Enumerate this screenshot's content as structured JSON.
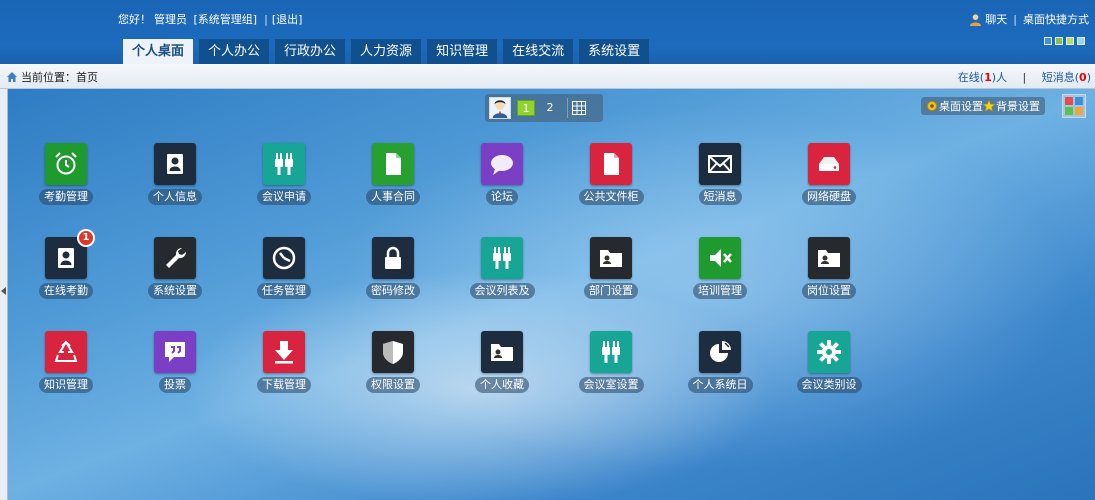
{
  "header": {
    "greeting": "您好！",
    "user_name": "管理员",
    "user_group": "[系统管理组]",
    "logout": "[退出]",
    "chat": "聊天",
    "shortcut": "桌面快捷方式"
  },
  "nav": {
    "tabs": [
      {
        "label": "个人桌面",
        "active": true
      },
      {
        "label": "个人办公",
        "active": false
      },
      {
        "label": "行政办公",
        "active": false
      },
      {
        "label": "人力资源",
        "active": false
      },
      {
        "label": "知识管理",
        "active": false
      },
      {
        "label": "在线交流",
        "active": false
      },
      {
        "label": "系统设置",
        "active": false
      }
    ]
  },
  "breadcrumb": {
    "label": "当前位置：",
    "current": "首页"
  },
  "status": {
    "online_label": "在线(",
    "online_count": "1",
    "online_suffix": ")人",
    "messages_label": "短消息(",
    "messages_count": "0",
    "messages_suffix": ")"
  },
  "pager": {
    "pages": [
      "1",
      "2"
    ],
    "active_page": "1"
  },
  "desk_tools": {
    "desktop_settings": "桌面设置",
    "background_settings": "背景设置"
  },
  "theme_colors": [
    "#3f8fdc",
    "#88c04a",
    "#b5e05d",
    "#9ed0f0"
  ],
  "apps": [
    {
      "label": "考勤管理",
      "color": "#1f9a2e",
      "icon": "alarm-clock-icon"
    },
    {
      "label": "个人信息",
      "color": "#1e2c3f",
      "icon": "person-icon"
    },
    {
      "label": "会议申请",
      "color": "#17a696",
      "icon": "plug-icon"
    },
    {
      "label": "人事合同",
      "color": "#27a030",
      "icon": "document-icon"
    },
    {
      "label": "论坛",
      "color": "#7a3fc4",
      "icon": "speech-bubble-icon"
    },
    {
      "label": "公共文件柜",
      "color": "#d8243f",
      "icon": "file-icon"
    },
    {
      "label": "短消息",
      "color": "#1e2c3f",
      "icon": "envelope-icon"
    },
    {
      "label": "网络硬盘",
      "color": "#d8243f",
      "icon": "hard-drive-icon"
    },
    {
      "label": "在线考勤",
      "color": "#1e2c3f",
      "icon": "person-icon",
      "badge": "1"
    },
    {
      "label": "系统设置",
      "color": "#262a2e",
      "icon": "wrench-icon"
    },
    {
      "label": "任务管理",
      "color": "#1e2c3f",
      "icon": "clock-icon"
    },
    {
      "label": "密码修改",
      "color": "#1e2c3f",
      "icon": "lock-icon"
    },
    {
      "label": "会议列表及",
      "color": "#17a696",
      "icon": "plug-icon"
    },
    {
      "label": "部门设置",
      "color": "#262a2e",
      "icon": "id-folder-icon"
    },
    {
      "label": "培训管理",
      "color": "#1f9a2e",
      "icon": "speaker-mute-icon"
    },
    {
      "label": "岗位设置",
      "color": "#262a2e",
      "icon": "id-folder-icon"
    },
    {
      "label": "知识管理",
      "color": "#d8243f",
      "icon": "recycle-icon"
    },
    {
      "label": "投票",
      "color": "#7a3fc4",
      "icon": "quote-bubble-icon"
    },
    {
      "label": "下载管理",
      "color": "#d8243f",
      "icon": "download-arrow-icon"
    },
    {
      "label": "权限设置",
      "color": "#262a2e",
      "icon": "shield-icon"
    },
    {
      "label": "个人收藏",
      "color": "#1e2c3f",
      "icon": "id-folder-icon"
    },
    {
      "label": "会议室设置",
      "color": "#17a696",
      "icon": "plug-icon"
    },
    {
      "label": "个人系统日",
      "color": "#1e2c3f",
      "icon": "pie-chart-icon"
    },
    {
      "label": "会议类别设",
      "color": "#17a696",
      "icon": "gear-icon"
    }
  ]
}
